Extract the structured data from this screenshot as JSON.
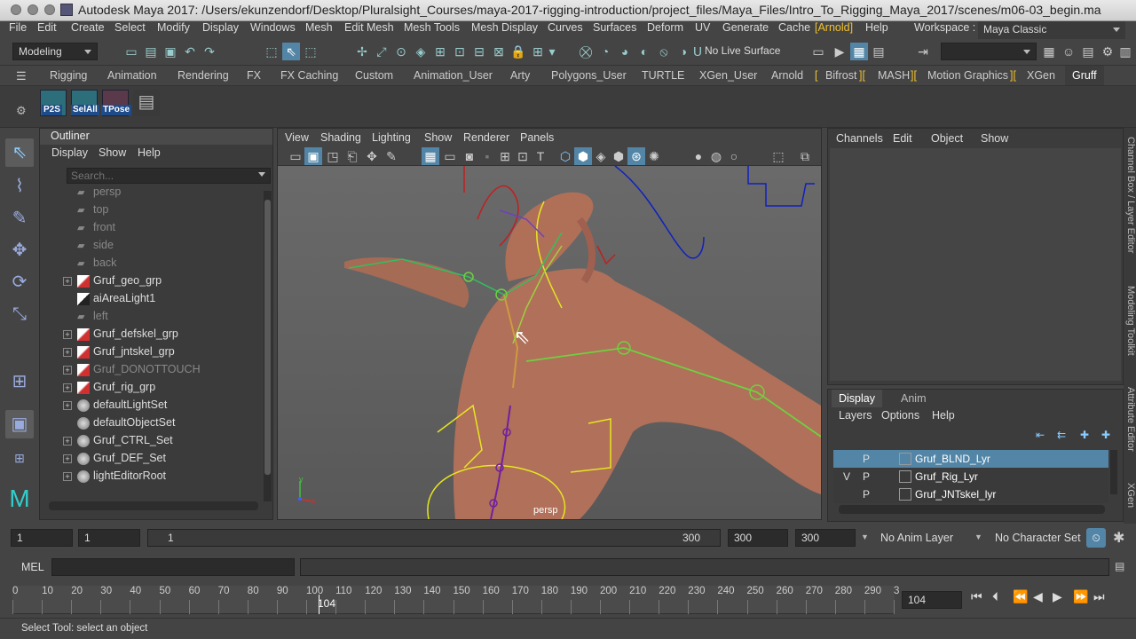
{
  "window": {
    "title": "Autodesk Maya 2017: /Users/ekunzendorf/Desktop/Pluralsight_Courses/maya-2017-rigging-introduction/project_files/Maya_Files/Intro_To_Rigging_Maya_2017/scenes/m06-03_begin.ma"
  },
  "menubar": [
    "File",
    "Edit",
    "Create",
    "Select",
    "Modify",
    "Display",
    "Windows",
    "Mesh",
    "Edit Mesh",
    "Mesh Tools",
    "Mesh Display",
    "Curves",
    "Surfaces",
    "Deform",
    "UV",
    "Generate",
    "Cache",
    "[Arnold]",
    "Help"
  ],
  "workspace": {
    "label": "Workspace :",
    "value": "Maya Classic"
  },
  "statusline": {
    "mode": "Modeling",
    "live_surface": "No Live Surface"
  },
  "shelf_tabs": [
    "Rigging",
    "Animation",
    "Rendering",
    "FX",
    "FX Caching",
    "Custom",
    "Animation_User",
    "Arty",
    "Polygons_User",
    "TURTLE",
    "XGen_User",
    "Arnold",
    "Bifrost",
    "MASH",
    "Motion Graphics",
    "XGen",
    "Gruff"
  ],
  "shelf_active": "Gruff",
  "shelf_buttons": [
    "P2S",
    "SelAll",
    "TPose"
  ],
  "outliner": {
    "title": "Outliner",
    "menu": [
      "Display",
      "Show",
      "Help"
    ],
    "search_placeholder": "Search...",
    "items": [
      {
        "label": "persp",
        "expandable": false,
        "dim": true,
        "icon": "camera-icon"
      },
      {
        "label": "top",
        "expandable": false,
        "dim": true,
        "icon": "camera-icon"
      },
      {
        "label": "front",
        "expandable": false,
        "dim": true,
        "icon": "camera-icon"
      },
      {
        "label": "side",
        "expandable": false,
        "dim": true,
        "icon": "camera-icon"
      },
      {
        "label": "back",
        "expandable": false,
        "dim": true,
        "icon": "camera-icon"
      },
      {
        "label": "Gruf_geo_grp",
        "expandable": true,
        "dim": false,
        "icon": "group-icon"
      },
      {
        "label": "aiAreaLight1",
        "expandable": false,
        "dim": false,
        "icon": "light-icon"
      },
      {
        "label": "left",
        "expandable": false,
        "dim": true,
        "icon": "camera-icon"
      },
      {
        "label": "Gruf_defskel_grp",
        "expandable": true,
        "dim": false,
        "icon": "group-icon"
      },
      {
        "label": "Gruf_jntskel_grp",
        "expandable": true,
        "dim": false,
        "icon": "group-icon"
      },
      {
        "label": "Gruf_DONOTTOUCH",
        "expandable": true,
        "dim": true,
        "icon": "group-icon"
      },
      {
        "label": "Gruf_rig_grp",
        "expandable": true,
        "dim": false,
        "icon": "group-icon"
      },
      {
        "label": "defaultLightSet",
        "expandable": true,
        "dim": false,
        "icon": "set-icon"
      },
      {
        "label": "defaultObjectSet",
        "expandable": false,
        "dim": false,
        "icon": "set-icon"
      },
      {
        "label": "Gruf_CTRL_Set",
        "expandable": true,
        "dim": false,
        "icon": "set-icon"
      },
      {
        "label": "Gruf_DEF_Set",
        "expandable": true,
        "dim": false,
        "icon": "set-icon"
      },
      {
        "label": "lightEditorRoot",
        "expandable": true,
        "dim": false,
        "icon": "set-icon"
      }
    ]
  },
  "viewport": {
    "menu": [
      "View",
      "Shading",
      "Lighting",
      "Show",
      "Renderer",
      "Panels"
    ],
    "camera_label": "persp",
    "axis_y": "y",
    "axis_x": "x"
  },
  "channelbox": {
    "menu": [
      "Channels",
      "Edit",
      "Object",
      "Show"
    ]
  },
  "layers": {
    "tabs": [
      "Display",
      "Anim"
    ],
    "menu": [
      "Layers",
      "Options",
      "Help"
    ],
    "rows": [
      {
        "v": "",
        "p": "P",
        "name": "Gruf_BLND_Lyr",
        "selected": true
      },
      {
        "v": "V",
        "p": "P",
        "name": "Gruf_Rig_Lyr",
        "selected": false
      },
      {
        "v": "",
        "p": "P",
        "name": "Gruf_JNTskel_lyr",
        "selected": false
      }
    ]
  },
  "side_tabs": [
    "Channel Box / Layer Editor",
    "Modeling Toolkit",
    "Attribute Editor",
    "XGen"
  ],
  "range": {
    "start": "1",
    "anim_start": "1",
    "range_min": "1",
    "range_max": "300",
    "end": "300",
    "anim_end": "300",
    "anim_layer": "No Anim Layer",
    "character_set": "No Character Set"
  },
  "mel": {
    "label": "MEL"
  },
  "timeline": {
    "ticks": [
      "0",
      "10",
      "20",
      "30",
      "40",
      "50",
      "60",
      "70",
      "80",
      "90",
      "100",
      "110",
      "120",
      "130",
      "140",
      "150",
      "160",
      "170",
      "180",
      "190",
      "200",
      "210",
      "220",
      "230",
      "240",
      "250",
      "260",
      "270",
      "280",
      "290",
      "3"
    ],
    "current_frame": "104",
    "frame_field": "104"
  },
  "helpline": {
    "text": "Select Tool: select an object"
  },
  "colors": {
    "accent": "#5285a6",
    "bg": "#444444",
    "arnold": "#f0c030"
  }
}
